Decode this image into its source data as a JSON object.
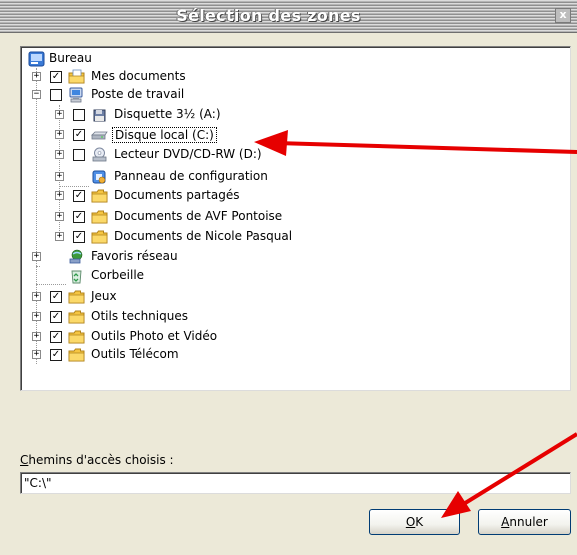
{
  "window": {
    "title": "Sélection des zones",
    "close_glyph": "x"
  },
  "tree": {
    "root": {
      "label": "Bureau",
      "icon": "desktop-icon"
    },
    "items": [
      {
        "label": "Mes documents",
        "checked": true,
        "icon": "folder-icon"
      },
      {
        "label": "Poste de travail",
        "checked": false,
        "icon": "computer-icon",
        "expanded": true
      },
      {
        "label": "Disquette 3½ (A:)",
        "checked": false,
        "icon": "floppy-icon"
      },
      {
        "label": "Disque local (C:)",
        "checked": true,
        "icon": "hard-drive-icon",
        "selected": true
      },
      {
        "label": "Lecteur DVD/CD-RW (D:)",
        "checked": false,
        "icon": "cd-drive-icon"
      },
      {
        "label": "Panneau de configuration",
        "icon": "control-panel-icon"
      },
      {
        "label": "Documents partagés",
        "checked": true,
        "icon": "folder-icon"
      },
      {
        "label": "Documents de AVF Pontoise",
        "checked": true,
        "icon": "folder-icon"
      },
      {
        "label": "Documents de Nicole Pasqual",
        "checked": true,
        "icon": "folder-icon"
      },
      {
        "label": "Favoris réseau",
        "icon": "network-icon"
      },
      {
        "label": "Corbeille",
        "icon": "recycle-bin-icon"
      },
      {
        "label": "Jeux",
        "checked": true,
        "icon": "folder-icon"
      },
      {
        "label": "Otils techniques",
        "checked": true,
        "icon": "folder-icon"
      },
      {
        "label": "Outils Photo et Vidéo",
        "checked": true,
        "icon": "folder-icon"
      },
      {
        "label": "Outils Télécom",
        "checked": true,
        "icon": "folder-icon"
      }
    ]
  },
  "path": {
    "label_mnemonic": "C",
    "label_rest": "hemins d'accès choisis :",
    "value": "\"C:\\\""
  },
  "buttons": {
    "ok_mnemonic": "O",
    "ok_rest": "K",
    "cancel_mnemonic": "A",
    "cancel_rest": "nnuler"
  },
  "colors": {
    "annotation_arrow": "#e60000",
    "titlebar_text": "#ffffff",
    "dialog_background": "#ece9d8"
  }
}
